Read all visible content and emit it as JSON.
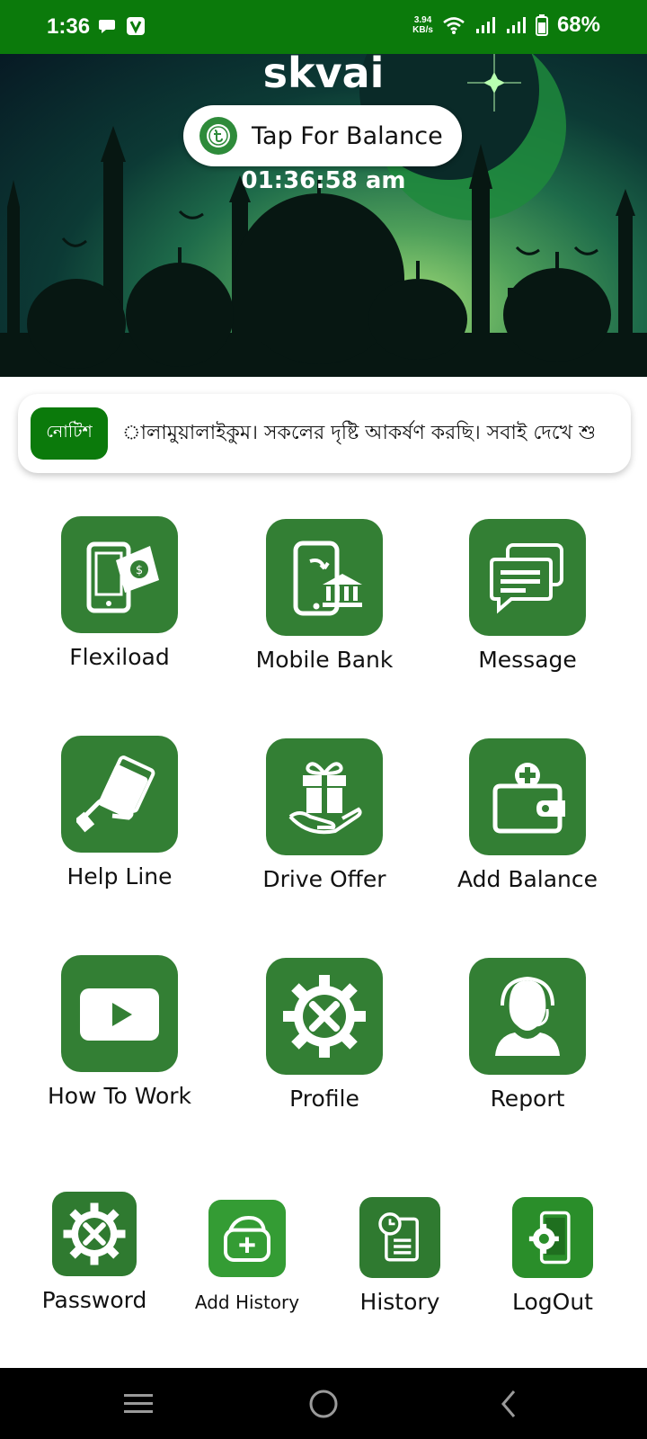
{
  "status_bar": {
    "time": "1:36",
    "net_speed_value": "3.94",
    "net_speed_unit": "KB/s",
    "battery": "68%"
  },
  "header": {
    "app_name": "skvai",
    "balance_button_label": "Tap For Balance",
    "clock": "01:36:58 am"
  },
  "notice": {
    "badge": "নোটিশ",
    "text": "ালামুয়ালাইকুম। সকলের দৃষ্টি আকর্ষণ করছি। সবাই দেখে শু"
  },
  "menu": {
    "flexiload": "Flexiload",
    "mobile_bank": "Mobile Bank",
    "message": "Message",
    "help_line": "Help Line",
    "drive_offer": "Drive Offer",
    "add_balance": "Add Balance",
    "how_to_work": "How To Work",
    "profile": "Profile",
    "report": "Report"
  },
  "bottom_menu": {
    "password": "Password",
    "add_history": "Add History",
    "history": "History",
    "logout": "LogOut"
  },
  "colors": {
    "status_bar": "#0b7a0b",
    "tile_green": "#337f34",
    "notice_badge": "#0b7a0b"
  },
  "icons": {
    "flexiload": "phone-money-icon",
    "mobile_bank": "phone-bank-icon",
    "message": "chat-bubbles-icon",
    "help_line": "hand-money-icon",
    "drive_offer": "gift-hand-icon",
    "add_balance": "wallet-plus-icon",
    "how_to_work": "play-video-icon",
    "profile": "gear-tools-icon",
    "report": "support-agent-icon",
    "password": "gear-tools-icon",
    "add_history": "bag-plus-icon",
    "history": "clipboard-clock-icon",
    "logout": "phone-gear-icon"
  }
}
